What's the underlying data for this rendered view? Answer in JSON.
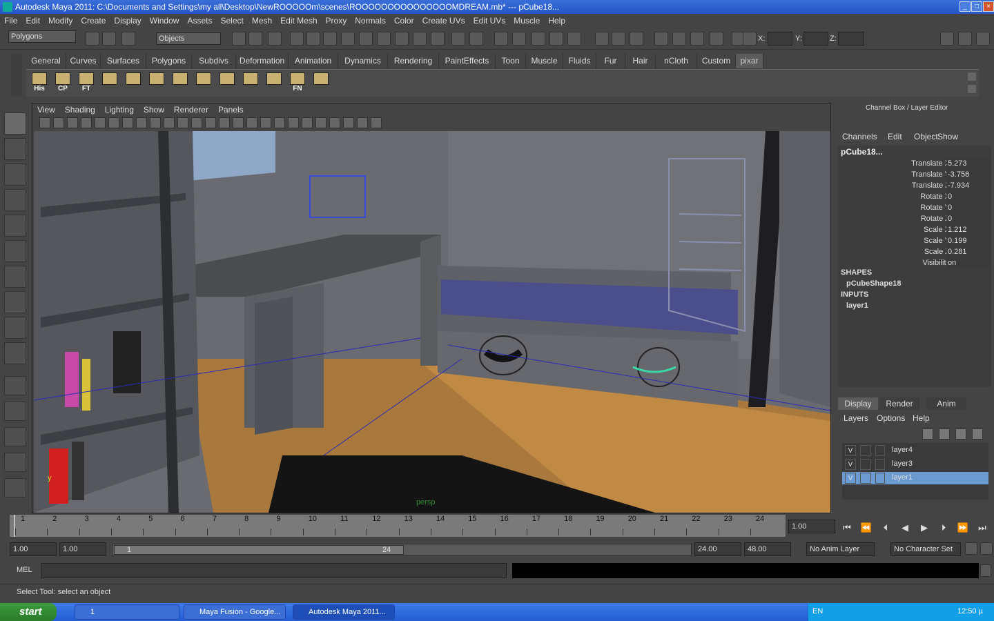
{
  "window": {
    "title": "Autodesk Maya 2011: C:\\Documents and Settings\\my all\\Desktop\\NewROOOOOm\\scenes\\ROOOOOOOOOOOOOOOMDREAM.mb*  ---  pCube18...",
    "min": "_",
    "max": "□",
    "close": "×"
  },
  "menubar": [
    "File",
    "Edit",
    "Modify",
    "Create",
    "Display",
    "Window",
    "Assets",
    "Select",
    "Mesh",
    "Edit Mesh",
    "Proxy",
    "Normals",
    "Color",
    "Create UVs",
    "Edit UVs",
    "Muscle",
    "Help"
  ],
  "statusline": {
    "menuset": "Polygons",
    "selection_mode": "Objects",
    "x_label": "X:",
    "y_label": "Y:",
    "z_label": "Z:"
  },
  "shelf_tabs": [
    "General",
    "Curves",
    "Surfaces",
    "Polygons",
    "Subdivs",
    "Deformation",
    "Animation",
    "Dynamics",
    "Rendering",
    "PaintEffects",
    "Toon",
    "Muscle",
    "Fluids",
    "Fur",
    "Hair",
    "nCloth",
    "Custom",
    "pixar"
  ],
  "shelf_active": "pixar",
  "shelf_buttons": [
    "His",
    "CP",
    "FT",
    "",
    "",
    "",
    "",
    "",
    "",
    "",
    "",
    "FN",
    ""
  ],
  "viewport": {
    "menu": [
      "View",
      "Shading",
      "Lighting",
      "Show",
      "Renderer",
      "Panels"
    ],
    "camera_label": "persp",
    "axis_y": "y"
  },
  "channel_box": {
    "title": "Channel Box / Layer Editor",
    "menu": [
      "Channels",
      "Edit",
      "Object",
      "Show"
    ],
    "object_name": "pCube18...",
    "channels": [
      {
        "label": "Translate X",
        "value": "5.273"
      },
      {
        "label": "Translate Y",
        "value": "-3.758"
      },
      {
        "label": "Translate Z",
        "value": "-7.934"
      },
      {
        "label": "Rotate X",
        "value": "0"
      },
      {
        "label": "Rotate Y",
        "value": "0"
      },
      {
        "label": "Rotate Z",
        "value": "0"
      },
      {
        "label": "Scale X",
        "value": "1.212"
      },
      {
        "label": "Scale Y",
        "value": "0.199"
      },
      {
        "label": "Scale Z",
        "value": "0.281"
      },
      {
        "label": "Visibility",
        "value": "on"
      }
    ],
    "shapes_header": "SHAPES",
    "shape_name": "pCubeShape18",
    "inputs_header": "INPUTS",
    "input_name": "layer1"
  },
  "layer_editor": {
    "tabs": [
      "Display",
      "Render",
      "Anim"
    ],
    "active_tab": "Display",
    "menu": [
      "Layers",
      "Options",
      "Help"
    ],
    "layers": [
      {
        "v": "V",
        "name": "layer4",
        "selected": false
      },
      {
        "v": "V",
        "name": "layer3",
        "selected": false
      },
      {
        "v": "V",
        "name": "layer1",
        "selected": true
      }
    ]
  },
  "timeline": {
    "ticks": [
      "1",
      "2",
      "3",
      "4",
      "5",
      "6",
      "7",
      "8",
      "9",
      "10",
      "11",
      "12",
      "13",
      "14",
      "15",
      "16",
      "17",
      "18",
      "19",
      "20",
      "21",
      "22",
      "23",
      "24"
    ],
    "current_frame": "1.00"
  },
  "range": {
    "start": "1.00",
    "playback_start": "1.00",
    "slider_start": "1",
    "slider_end": "24",
    "playback_end": "24.00",
    "end": "48.00",
    "anim_layer": "No Anim Layer",
    "char_set": "No Character Set"
  },
  "command_line": {
    "label": "MEL"
  },
  "help_line": "Select Tool: select an object",
  "taskbar": {
    "start": "start",
    "tasks": [
      "1",
      "Maya Fusion - Google...",
      "Autodesk Maya 2011..."
    ],
    "lang": "EN",
    "clock": "12:50 µ"
  }
}
